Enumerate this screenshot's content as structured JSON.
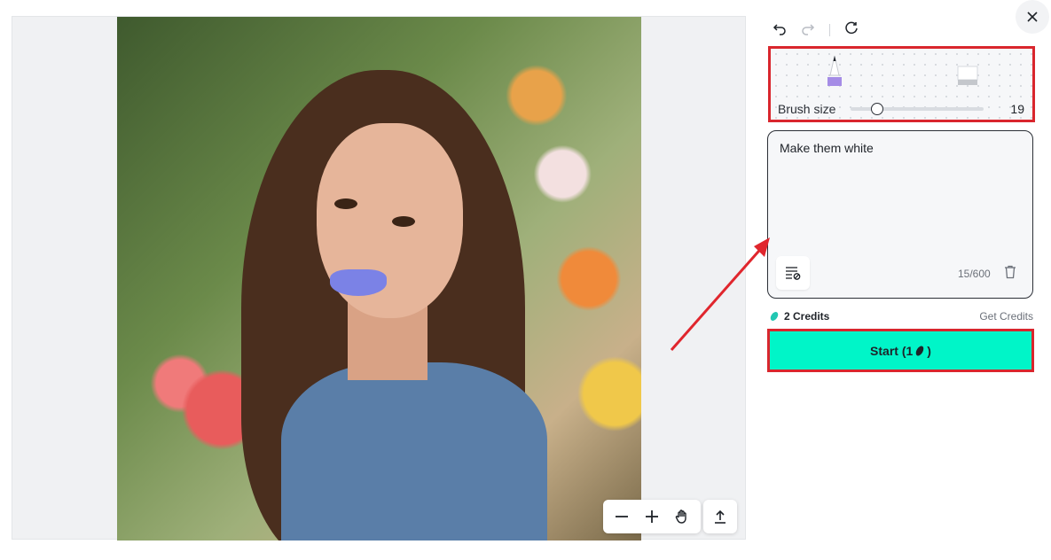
{
  "brush": {
    "label": "Brush size",
    "value": "19",
    "level": 0.2
  },
  "prompt": {
    "text": "Make them white",
    "char_count": "15/600"
  },
  "credits": {
    "label": "2 Credits",
    "get_credits": "Get Credits"
  },
  "start_button": {
    "label": "Start (1"
  },
  "colors": {
    "accent": "#00f5c8",
    "highlight": "#d9262d",
    "mask": "#7b82e6"
  },
  "icons": [
    "undo-icon",
    "redo-icon",
    "reset-icon",
    "close-icon",
    "pencil-icon",
    "eraser-icon",
    "zoom-out-icon",
    "zoom-in-icon",
    "hand-icon",
    "export-icon",
    "clear-format-icon",
    "trash-icon",
    "credit-bean-icon"
  ]
}
